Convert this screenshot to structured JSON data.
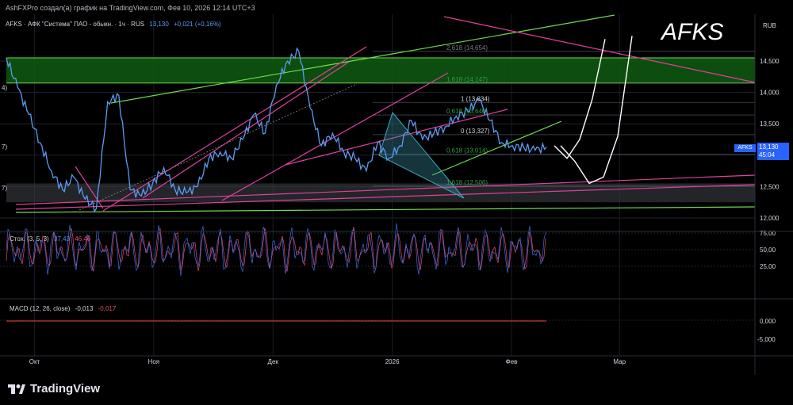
{
  "caption": "AshFXPro создал(а) график на TradingView.com, Фев 10, 2026 12:14 UTC+3",
  "watermark_title": "AFKS",
  "currency": "RUB",
  "colors": {
    "price_line": "#5b9cf2",
    "green_zone": "#0f5a12",
    "green_line": "#6ee04b",
    "magenta_line": "#e040a0",
    "stoch_k": "#3a6ee8",
    "stoch_d": "#e84a6a",
    "macd_line": "#c0392b",
    "accent_blue": "#2962ff"
  },
  "legend": {
    "symbol": "AFKS · АФК \"Система\" ПАО - обыкн. · 1ч · RUS",
    "price": "13,130",
    "change": "+0,021 (+0,16%)"
  },
  "price_tag": {
    "ticker": "AFKS",
    "value": "13,130",
    "countdown": "45:04"
  },
  "stoch_legend": {
    "name": "Стох. (3, 5, 3)",
    "k": "37,43",
    "d": "46,46"
  },
  "macd_legend": {
    "name": "MACD (12, 26, close)",
    "macd": "-0,013",
    "signal": "-0,017"
  },
  "fib_labels": [
    {
      "text": "2,618 (14,654)"
    },
    {
      "text": "1,618 (14,147)"
    },
    {
      "text": "1 (13,834)"
    },
    {
      "text": "0,618 (13,640)"
    },
    {
      "text": "0 (13,327)"
    },
    {
      "text": "0,618 (13,014)"
    },
    {
      "text": "1,618 (12,506)"
    }
  ],
  "left_edge_labels": [
    "4)",
    "7)",
    "7)"
  ],
  "brand": "TradingView",
  "chart_data": {
    "type": "line",
    "title": "AFKS",
    "price_axis_ticks": [
      "14,500",
      "14,000",
      "13,500",
      "13,000",
      "12,500",
      "12,000"
    ],
    "price_axis_values": [
      14500,
      14000,
      13500,
      13000,
      12500,
      12000
    ],
    "ylim": [
      11850,
      15200
    ],
    "stoch_axis_ticks": [
      "75,00",
      "50,00",
      "25,00"
    ],
    "stoch_axis_values": [
      75,
      50,
      25
    ],
    "macd_axis_ticks": [
      "0,000",
      "-5,000"
    ],
    "time_labels": [
      "Окт",
      "Ноя",
      "Дек",
      "2026",
      "Фев",
      "Мар"
    ],
    "x_index_range": [
      0,
      480
    ],
    "time_label_positions": [
      25,
      131,
      237,
      343,
      449,
      545
    ],
    "price_x": [
      0,
      10,
      20,
      30,
      40,
      50,
      60,
      70,
      80,
      90,
      100,
      110,
      120,
      130,
      140,
      150,
      160,
      170,
      180,
      190,
      200,
      210,
      220,
      230,
      240,
      250,
      260,
      270,
      280,
      290,
      300,
      310,
      320,
      330,
      340,
      350,
      360,
      370,
      380,
      390,
      400,
      410,
      420,
      430,
      440,
      450,
      460,
      470,
      480
    ],
    "price_y": [
      14550,
      14080,
      13650,
      13200,
      12750,
      12450,
      12650,
      12300,
      12150,
      13850,
      13950,
      12450,
      12350,
      12550,
      12800,
      12450,
      12400,
      12500,
      12950,
      13050,
      12950,
      13250,
      13650,
      13350,
      14120,
      14500,
      14650,
      13750,
      13150,
      13350,
      13050,
      12950,
      12750,
      13200,
      12950,
      13150,
      13550,
      13250,
      13350,
      13450,
      13620,
      13700,
      13880,
      13550,
      13200,
      13150,
      13120,
      13080,
      13130
    ],
    "projection_1_y": [
      13150,
      12950,
      13250,
      13900,
      14850
    ],
    "projection_2_y": [
      13150,
      12900,
      12550,
      12650,
      13300,
      14900
    ],
    "zone": {
      "from": 14150,
      "to": 14550
    },
    "gray_band": {
      "from": 12250,
      "to": 12550
    },
    "fib_levels": [
      14654,
      14147,
      13834,
      13640,
      13327,
      13014,
      12506
    ]
  }
}
